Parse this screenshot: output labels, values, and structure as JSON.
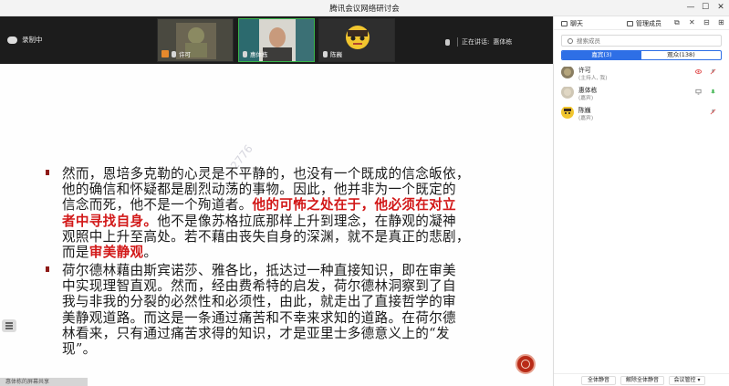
{
  "window": {
    "title": "腾讯会议网络研讨会",
    "controls": [
      "—",
      "☐",
      "✕"
    ]
  },
  "topbar": {
    "recording_label": "录制中",
    "participants": [
      {
        "name": "许可",
        "badge_color": "#e7892c"
      },
      {
        "name": "惠体栋",
        "badge_color": "#cfcfcf"
      },
      {
        "name": "陈巍",
        "badge_color": "#cfcfcf"
      }
    ],
    "speaking_label": "正在讲话:",
    "speaking_name": "惠体栋"
  },
  "slide": {
    "watermark": "2776",
    "share_bar_label": "惠体栋的屏幕共享",
    "paragraph1": {
      "line1": "然而，恩培多克勒的心灵是不平静的，也没有一个既成的信念皈依，",
      "line2": "他的确信和怀疑都是剧烈动荡的事物。因此，他并非为一个既定的",
      "line3a": "信念而死，他不是一个殉道者。",
      "line3b": "他的可怖之处在于，他必须在对立",
      "line4a": "者中寻找自身。",
      "line4b": "他不是像苏格拉底那样上升到理念，在静观的凝神",
      "line5": "观照中上升至高处。若不藉由丧失自身的深渊，就不是真正的悲剧，",
      "line6a": "而是",
      "line6b": "审美静观",
      "line6c": "。"
    },
    "paragraph2": {
      "line1": "荷尔德林藉由斯宾诺莎、雅各比，抵达过一种直接知识，即在审美",
      "line2": "中实现理智直观。然而，经由费希特的启发，荷尔德林洞察到了自",
      "line3": "我与非我的分裂的必然性和必须性，由此，就走出了直接哲学的审",
      "line4": "美静观道路。而这是一条通过痛苦和不幸来求知的道路。在荷尔德",
      "line5": "林看来，只有通过痛苦求得的知识，才是亚里士多德意义上的“发",
      "line6": "现”。"
    }
  },
  "panel": {
    "tab_chat": "聊天",
    "tab_members": "管理成员",
    "search_placeholder": "搜索成员",
    "seg_guests": "嘉宾(3)",
    "seg_viewers": "观众(138)",
    "members": [
      {
        "name": "许可",
        "role": "(主持人, 我)"
      },
      {
        "name": "惠体栋",
        "role": "(嘉宾)"
      },
      {
        "name": "陈巍",
        "role": "(嘉宾)"
      }
    ],
    "btn_mute_all": "全体静音",
    "btn_unmute_all": "解除全体静音",
    "btn_meeting_control": "会议管控",
    "btn_meeting_control_arrow": "▾"
  },
  "colors": {
    "accent_blue": "#2e6fe6",
    "emphasis_red": "#d21818",
    "bullet_marker": "#8e1a17"
  }
}
